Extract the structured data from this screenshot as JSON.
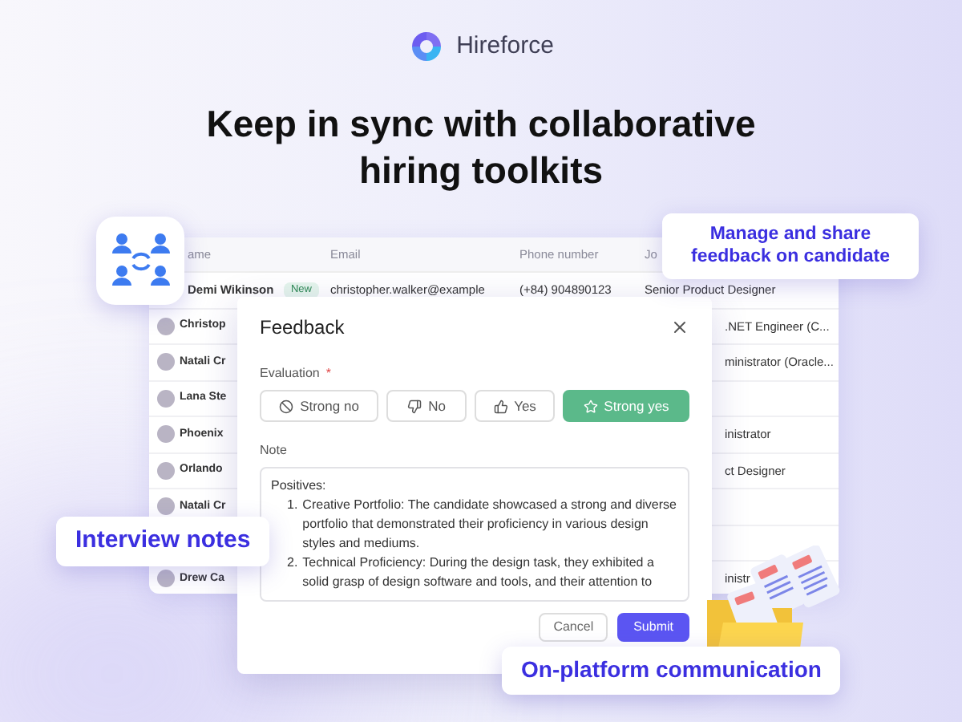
{
  "brand": {
    "name": "Hireforce"
  },
  "headline": "Keep in sync with collaborative hiring toolkits",
  "table": {
    "columns": [
      "ame",
      "Email",
      "Phone number",
      "Jo"
    ],
    "rows": [
      {
        "name": "Demi Wikinson",
        "badge": "New",
        "email": "christopher.walker@example",
        "phone": "(+84) 904890123",
        "job": "Senior Product Designer"
      },
      {
        "name": "Christop",
        "job": ".NET Engineer (C..."
      },
      {
        "name": "Natali Cr",
        "job": "ministrator (Oracle..."
      },
      {
        "name": "Lana Ste"
      },
      {
        "name": "Phoenix",
        "job": "inistrator"
      },
      {
        "name": "Orlando",
        "job": "ct Designer"
      },
      {
        "name": "Natali Cr"
      },
      {},
      {
        "name": "Drew Ca",
        "job": "inistr"
      }
    ]
  },
  "modal": {
    "title": "Feedback",
    "evaluation_label": "Evaluation",
    "required_mark": "*",
    "options": [
      {
        "kind": "ban",
        "label": "Strong no",
        "selected": false
      },
      {
        "kind": "thumbs-down",
        "label": "No",
        "selected": false
      },
      {
        "kind": "thumbs-up",
        "label": "Yes",
        "selected": false
      },
      {
        "kind": "star",
        "label": "Strong yes",
        "selected": true
      }
    ],
    "note_label": "Note",
    "note_heading": "Positives:",
    "note_items": [
      {
        "number": "1.",
        "text": "Creative Portfolio: The candidate showcased a strong and diverse portfolio that demonstrated their proficiency in various design styles and mediums."
      },
      {
        "number": "2.",
        "text": "Technical Proficiency: During the design task, they exhibited a solid grasp of design software and tools, and their attention to"
      }
    ],
    "buttons": [
      "Cancel",
      "Submit"
    ]
  },
  "callouts": [
    "Manage and share feedback on candidate",
    "Interview notes",
    "On-platform communication"
  ]
}
